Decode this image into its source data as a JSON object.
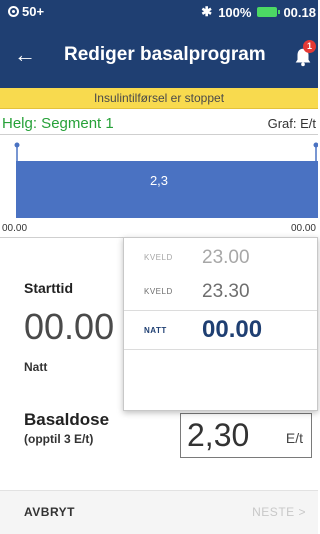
{
  "status_bar": {
    "signal": "50+",
    "bluetooth": "✱",
    "battery": "100%",
    "time": "00.18",
    "icons": [
      "pod-icon",
      "bluetooth-icon",
      "battery-icon"
    ],
    "battery_color": "#4cd964"
  },
  "header": {
    "back_icon": "←",
    "title": "Rediger basalprogram",
    "notification_count": "1",
    "background": "#1f3f72"
  },
  "banner": {
    "text": "Insulintilførsel er stoppet",
    "color": "#f8da4e"
  },
  "segment": {
    "name": "Helg: Segment 1",
    "graph_label": "Graf: E/t"
  },
  "chart_data": {
    "type": "area",
    "x_start": "00.00",
    "x_end": "00.00",
    "value": 2.3,
    "value_label": "2,3",
    "fill": "#4a72c2"
  },
  "form": {
    "start_label": "Starttid",
    "start_value": "00.00",
    "start_period": "Natt",
    "basal_label": "Basaldose",
    "basal_hint": "(opptil 3 E/t)",
    "basal_value": "2,30",
    "basal_unit": "E/t"
  },
  "picker": {
    "options": [
      {
        "label": "KVELD",
        "time": "23.00"
      },
      {
        "label": "KVELD",
        "time": "23.30"
      },
      {
        "label": "NATT",
        "time": "00.00"
      }
    ]
  },
  "footer": {
    "cancel": "AVBRYT",
    "next": "NESTE >"
  }
}
